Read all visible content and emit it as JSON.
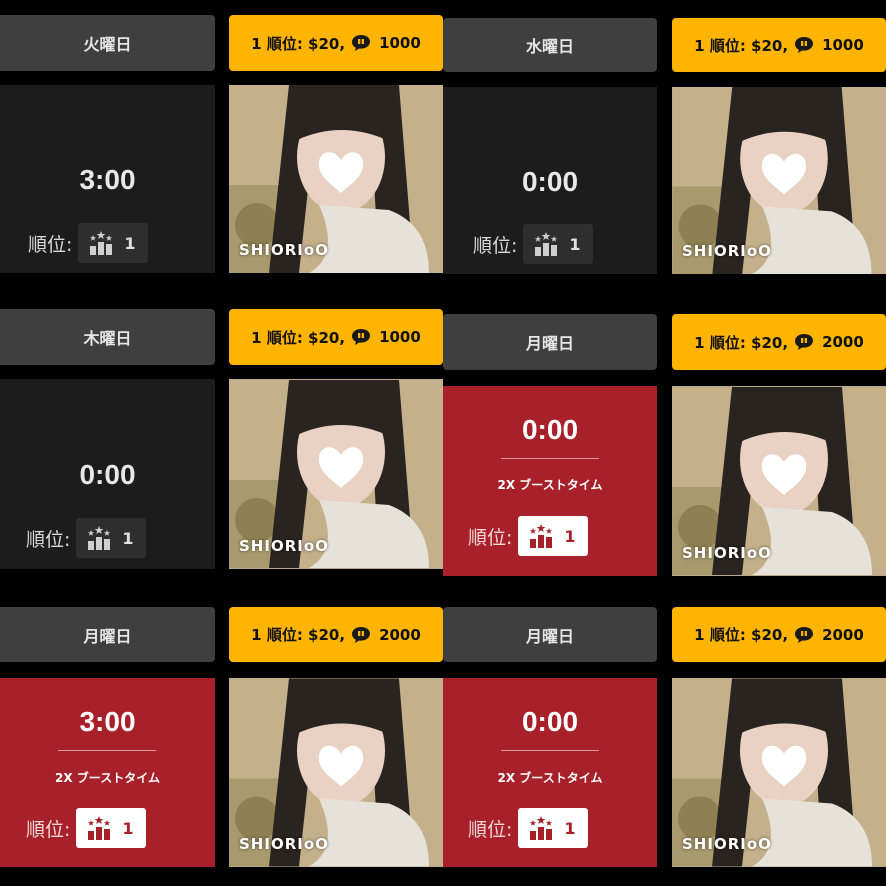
{
  "colors": {
    "background": "#000000",
    "day_header_bg": "#3f3f3f",
    "prize_bg": "#ffb400",
    "timer_bg": "#1c1c1c",
    "boost_bg": "#a8202a"
  },
  "icons": {
    "prize": "gift-chat-bubble-icon",
    "rank": "podium-stars-icon"
  },
  "rank_label": "順位:",
  "prize_rank": "1 順位: $20,",
  "cards": [
    {
      "day": "火曜日",
      "timer": "3:00",
      "rank": "1",
      "prize_points": "1000",
      "boost": false,
      "boost_label": "",
      "streamer": "SHIORIoO"
    },
    {
      "day": "水曜日",
      "timer": "0:00",
      "rank": "1",
      "prize_points": "1000",
      "boost": false,
      "boost_label": "",
      "streamer": "SHIORIoO"
    },
    {
      "day": "木曜日",
      "timer": "0:00",
      "rank": "1",
      "prize_points": "1000",
      "boost": false,
      "boost_label": "",
      "streamer": "SHIORIoO"
    },
    {
      "day": "月曜日",
      "timer": "0:00",
      "rank": "1",
      "prize_points": "2000",
      "boost": true,
      "boost_label": "2X ブーストタイム",
      "streamer": "SHIORIoO"
    },
    {
      "day": "月曜日",
      "timer": "3:00",
      "rank": "1",
      "prize_points": "2000",
      "boost": true,
      "boost_label": "2X ブーストタイム",
      "streamer": "SHIORIoO"
    },
    {
      "day": "月曜日",
      "timer": "0:00",
      "rank": "1",
      "prize_points": "2000",
      "boost": true,
      "boost_label": "2X ブーストタイム",
      "streamer": "SHIORIoO"
    }
  ]
}
